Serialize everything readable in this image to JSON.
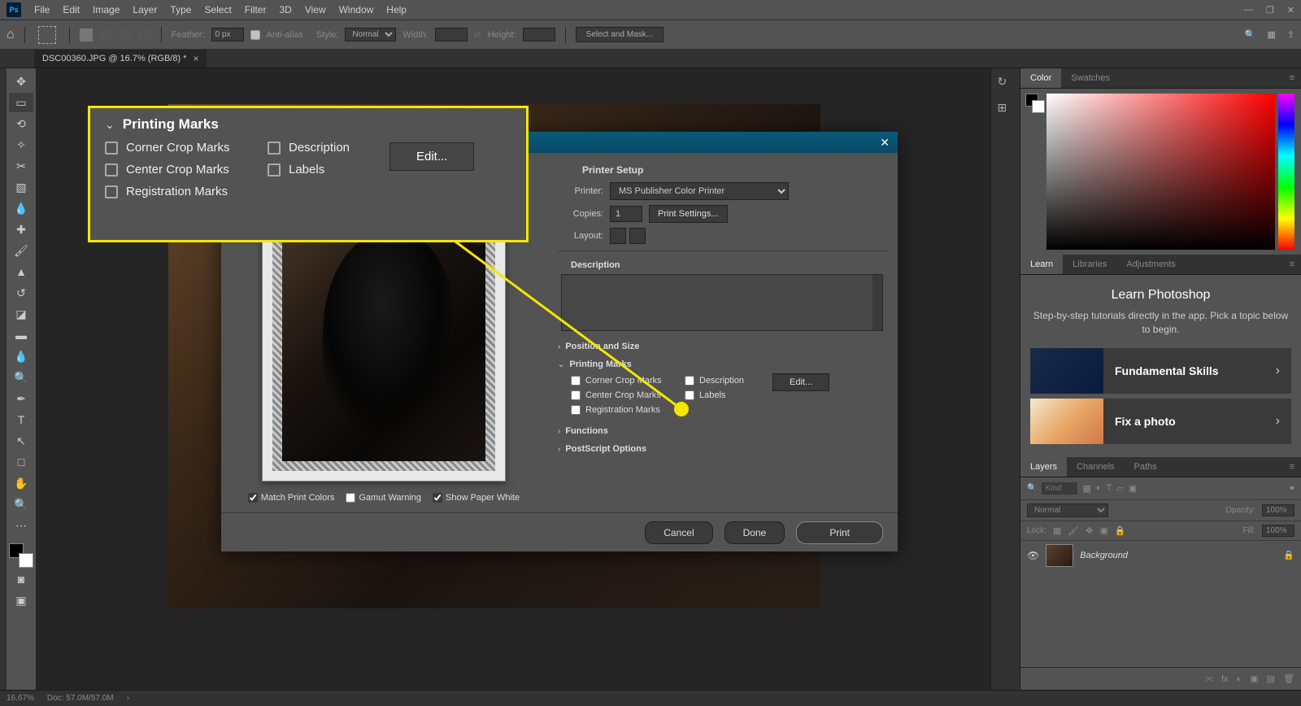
{
  "menubar": {
    "items": [
      "File",
      "Edit",
      "Image",
      "Layer",
      "Type",
      "Select",
      "Filter",
      "3D",
      "View",
      "Window",
      "Help"
    ]
  },
  "optionsbar": {
    "feather_label": "Feather:",
    "feather_value": "0 px",
    "antialias_label": "Anti-alias",
    "style_label": "Style:",
    "style_value": "Normal",
    "width_label": "Width:",
    "height_label": "Height:",
    "mask_button": "Select and Mask..."
  },
  "document": {
    "tab_title": "DSC00360.JPG @ 16.7% (RGB/8) *"
  },
  "panels": {
    "color_tabs": [
      "Color",
      "Swatches"
    ],
    "learn_tabs": [
      "Learn",
      "Libraries",
      "Adjustments"
    ],
    "learn_heading": "Learn Photoshop",
    "learn_desc": "Step-by-step tutorials directly in the app. Pick a topic below to begin.",
    "learn_tiles": [
      {
        "title": "Fundamental Skills"
      },
      {
        "title": "Fix a photo"
      }
    ],
    "layers_tabs": [
      "Layers",
      "Channels",
      "Paths"
    ],
    "layers_kind_placeholder": "Kind",
    "layers_blend": "Normal",
    "layers_opacity_label": "Opacity:",
    "layers_opacity_value": "100%",
    "layers_lock_label": "Lock:",
    "layers_fill_label": "Fill:",
    "layers_fill_value": "100%",
    "layer_name": "Background"
  },
  "print_dialog": {
    "printer_setup_label": "Printer Setup",
    "printer_label": "Printer:",
    "printer_value": "MS Publisher Color Printer",
    "copies_label": "Copies:",
    "copies_value": "1",
    "print_settings_btn": "Print Settings...",
    "layout_label": "Layout:",
    "description_section": "Description",
    "position_section": "Position and Size",
    "printing_marks_section": "Printing Marks",
    "marks": {
      "corner": "Corner Crop Marks",
      "center": "Center Crop Marks",
      "registration": "Registration Marks",
      "description": "Description",
      "labels": "Labels"
    },
    "edit_btn": "Edit...",
    "functions_section": "Functions",
    "postscript_section": "PostScript Options",
    "preview_match": "Match Print Colors",
    "preview_gamut": "Gamut Warning",
    "preview_paperwhite": "Show Paper White",
    "cancel_btn": "Cancel",
    "done_btn": "Done",
    "print_btn": "Print"
  },
  "callout": {
    "title": "Printing Marks",
    "corner": "Corner Crop Marks",
    "center": "Center Crop Marks",
    "registration": "Registration Marks",
    "description": "Description",
    "labels": "Labels",
    "edit_btn": "Edit..."
  },
  "statusbar": {
    "zoom": "16.67%",
    "doc_size": "Doc: 57.0M/57.0M"
  }
}
